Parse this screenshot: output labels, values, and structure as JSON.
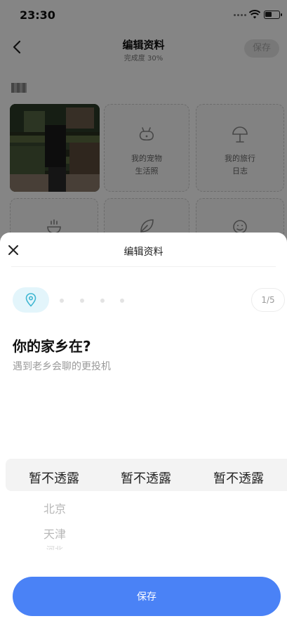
{
  "status_bar": {
    "time": "23:30"
  },
  "background": {
    "nav": {
      "title": "编辑资料",
      "subtitle": "完成度 30%",
      "save_label": "保存"
    },
    "tiles": [
      {
        "label": "我的宠物\n生活照",
        "icon": "pet-icon"
      },
      {
        "label": "我的旅行\n日志",
        "icon": "beach-umbrella-icon"
      }
    ]
  },
  "sheet": {
    "title": "编辑资料",
    "step": {
      "current": 1,
      "total": 5,
      "counter_label": "1/5",
      "icon": "location-pin-icon",
      "accent": "#3fb7d2"
    },
    "question": "你的家乡在?",
    "hint": "遇到老乡会聊的更投机",
    "picker": {
      "selected": [
        "暂不透露",
        "暂不透露",
        "暂不透露"
      ],
      "options": [
        "北京",
        "天津",
        "河北"
      ]
    },
    "save_label": "保存",
    "save_color": "#4a82f6"
  }
}
